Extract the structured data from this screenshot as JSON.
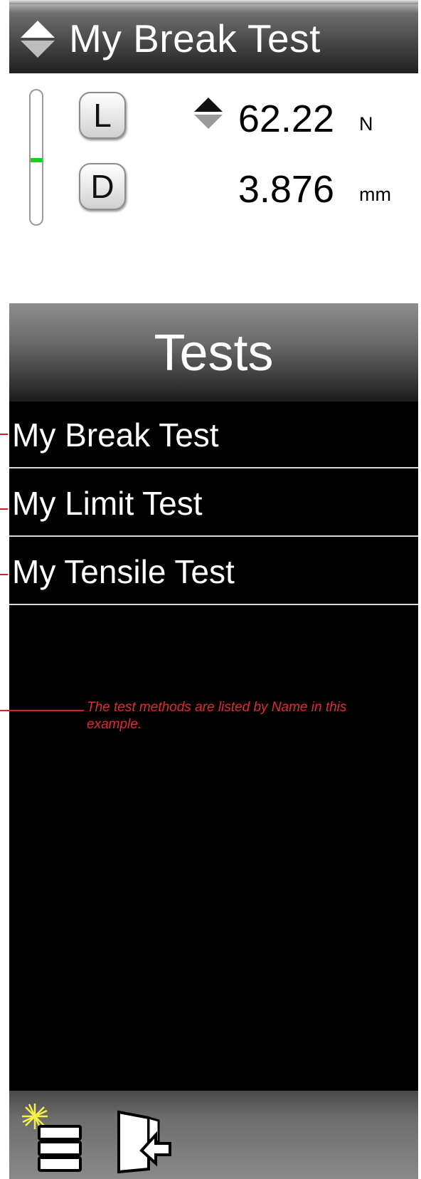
{
  "header": {
    "title": "My Break Test",
    "sort_icon": "up-down-arrows-icon"
  },
  "gauge": {
    "bar_level_fraction": 0.48,
    "load": {
      "key_label": "L",
      "value": "62.22",
      "unit": "N",
      "arrow_icon": "up-down-arrows-icon"
    },
    "displacement": {
      "key_label": "D",
      "value": "3.876",
      "unit": "mm"
    }
  },
  "section": {
    "title": "Tests"
  },
  "tests": {
    "items": [
      {
        "label": "My Break Test"
      },
      {
        "label": "My Limit Test"
      },
      {
        "label": "My Tensile Test"
      }
    ]
  },
  "footer": {
    "buttons": [
      {
        "icon": "new-test-list-icon"
      },
      {
        "icon": "exit-door-icon"
      }
    ]
  },
  "annotation": {
    "text": "The test methods are listed by Name in this example.",
    "color": "#e02a35"
  },
  "colors": {
    "level_indicator": "#18d018",
    "list_background": "#000000",
    "annotation_red": "#d0202a"
  }
}
